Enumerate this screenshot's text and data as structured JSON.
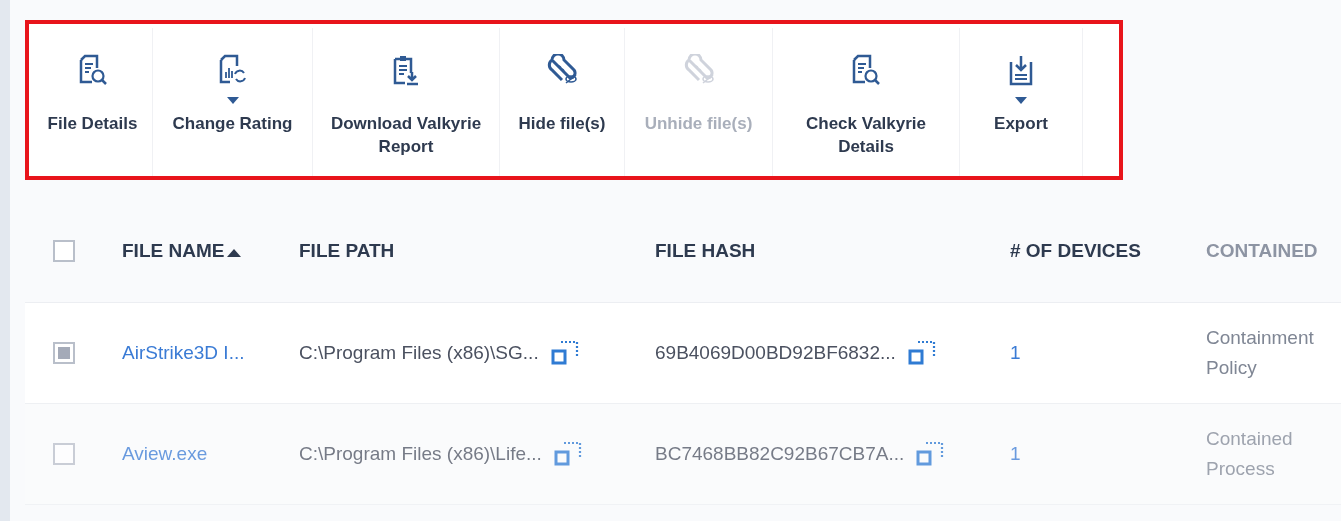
{
  "toolbar": {
    "buttons": [
      {
        "label": "File Details",
        "kind": "file-search",
        "dropdown": false,
        "disabled": false
      },
      {
        "label": "Change Rating",
        "kind": "rating",
        "dropdown": true,
        "disabled": false
      },
      {
        "label": "Download Valkyrie Report",
        "kind": "download",
        "dropdown": false,
        "disabled": false
      },
      {
        "label": "Hide file(s)",
        "kind": "hide",
        "dropdown": false,
        "disabled": false
      },
      {
        "label": "Unhide file(s)",
        "kind": "hide",
        "dropdown": false,
        "disabled": true
      },
      {
        "label": "Check Valkyrie Details",
        "kind": "file-search",
        "dropdown": false,
        "disabled": false
      },
      {
        "label": "Export",
        "kind": "export",
        "dropdown": true,
        "disabled": false
      }
    ]
  },
  "table": {
    "select_all": {
      "checked": false
    },
    "columns": [
      {
        "label": "FILE NAME",
        "sorted": true
      },
      {
        "label": "FILE PATH",
        "sorted": false
      },
      {
        "label": "FILE HASH",
        "sorted": false
      },
      {
        "label": "# OF DEVICES",
        "sorted": false
      },
      {
        "label": "CONTAINED",
        "sorted": false
      }
    ],
    "rows": [
      {
        "checked": true,
        "file_name": "AirStrike3D I...",
        "file_path": "C:\\Program Files (x86)\\SG...",
        "file_hash": "69B4069D00BD92BF6832...",
        "devices": "1",
        "contained_by": "Containment Policy"
      },
      {
        "checked": false,
        "file_name": "Aview.exe",
        "file_path": "C:\\Program Files (x86)\\Life...",
        "file_hash": "BC7468BB82C92B67CB7A...",
        "devices": "1",
        "contained_by": "Contained Process"
      }
    ]
  }
}
